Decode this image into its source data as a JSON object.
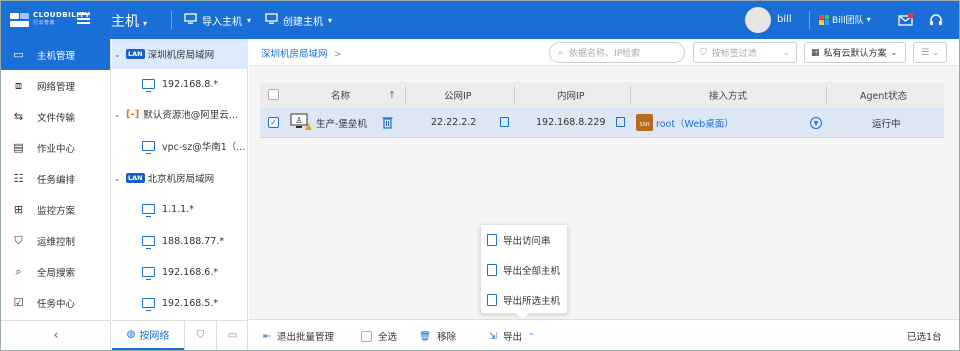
{
  "brand": {
    "name": "CLOUDBILITY",
    "sub": "行云管家"
  },
  "topbar": {
    "title": "主机",
    "import_label": "导入主机",
    "create_label": "创建主机",
    "user_name": "bill",
    "team_name": "Bill团队",
    "accent": "#1a6fd6"
  },
  "sidebar": {
    "items": [
      {
        "label": "主机管理",
        "icon": "monitor-icon"
      },
      {
        "label": "网络管理",
        "icon": "network-icon"
      },
      {
        "label": "文件传输",
        "icon": "file-transfer-icon"
      },
      {
        "label": "作业中心",
        "icon": "job-icon"
      },
      {
        "label": "任务编排",
        "icon": "task-icon"
      },
      {
        "label": "监控方案",
        "icon": "monitor-plan-icon"
      },
      {
        "label": "运维控制",
        "icon": "ops-control-icon"
      },
      {
        "label": "全局搜索",
        "icon": "search-icon"
      },
      {
        "label": "任务中心",
        "icon": "task-center-icon"
      }
    ],
    "collapse_glyph": "‹"
  },
  "tree": {
    "nodes": [
      {
        "label": "深圳机房局域网",
        "badge": "LAN"
      },
      {
        "label": "192.168.8.*"
      },
      {
        "label": "默认资源池@阿里云..."
      },
      {
        "label": "vpc-sz@华南1（..."
      },
      {
        "label": "北京机房局域网",
        "badge": "LAN"
      },
      {
        "label": "1.1.1.*"
      },
      {
        "label": "188.188.77.*"
      },
      {
        "label": "192.168.6.*"
      },
      {
        "label": "192.168.5.*"
      }
    ],
    "bottom_tab": "按网络"
  },
  "toolbar": {
    "breadcrumb": "深圳机房局域网",
    "breadcrumb_arrow": ">",
    "search_placeholder": "依据名称、IP检索",
    "tag_placeholder": "按标签过滤",
    "plan_label": "私有云默认方案"
  },
  "table": {
    "headers": [
      "名称",
      "公网IP",
      "内网IP",
      "接入方式",
      "Agent状态"
    ],
    "sort_glyph": "↑",
    "rows": [
      {
        "name": "生产-堡垒机",
        "public_ip": "22.22.2.2",
        "private_ip": "192.168.8.229",
        "access": "root（Web桌面）",
        "agent_status": "运行中",
        "ssh_badge": "SSH"
      }
    ]
  },
  "export_menu": {
    "items": [
      "导出访问串",
      "导出全部主机",
      "导出所选主机"
    ]
  },
  "bottombar": {
    "exit_batch": "退出批量管理",
    "select_all": "全选",
    "remove": "移除",
    "export": "导出",
    "selected_count": "已选1台"
  }
}
